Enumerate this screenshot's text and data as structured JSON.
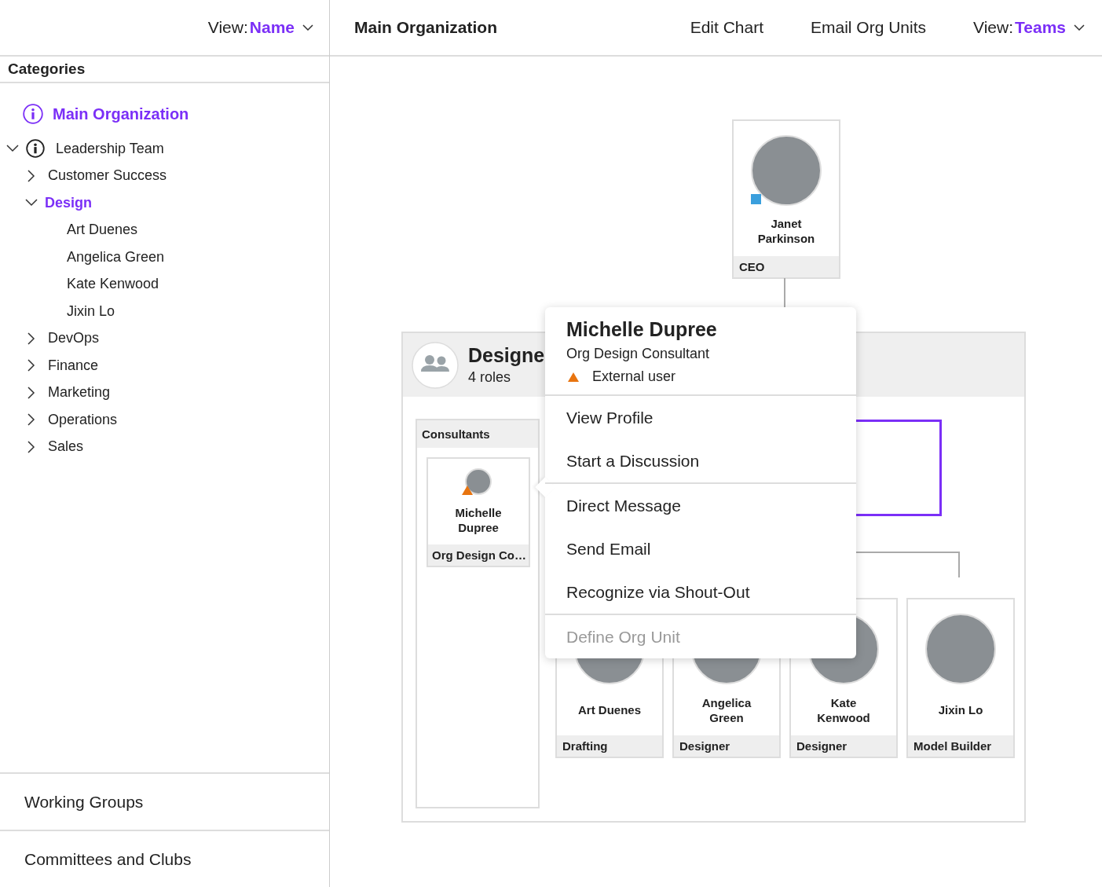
{
  "sidebar": {
    "view": {
      "label": "View:",
      "value": "Name"
    },
    "heading": "Categories",
    "tree": [
      {
        "label": "Main Organization",
        "kind": "root",
        "selected": true,
        "info": true
      },
      {
        "label": "Leadership Team",
        "kind": "group",
        "expanded": true,
        "selected": false,
        "info": true,
        "children": [
          {
            "label": "Customer Success",
            "kind": "group",
            "expanded": false,
            "selected": false,
            "info": false
          },
          {
            "label": "Design",
            "kind": "group",
            "expanded": true,
            "selected": true,
            "children": [
              {
                "label": "Art Duenes",
                "kind": "leaf",
                "selected": false
              },
              {
                "label": "Angelica Green",
                "kind": "leaf",
                "selected": false
              },
              {
                "label": "Kate Kenwood",
                "kind": "leaf",
                "selected": false
              },
              {
                "label": "Jixin Lo",
                "kind": "leaf",
                "selected": false
              }
            ]
          },
          {
            "label": "DevOps",
            "kind": "group",
            "expanded": false,
            "selected": false
          },
          {
            "label": "Finance",
            "kind": "group",
            "expanded": false,
            "selected": false
          },
          {
            "label": "Marketing",
            "kind": "group",
            "expanded": false,
            "selected": false
          },
          {
            "label": "Operations",
            "kind": "group",
            "expanded": false,
            "selected": false
          },
          {
            "label": "Sales",
            "kind": "group",
            "expanded": false,
            "selected": false
          }
        ]
      }
    ],
    "sections": [
      "Working Groups",
      "Committees and Clubs"
    ]
  },
  "header": {
    "title": "Main Organization",
    "actions": [
      "Edit Chart",
      "Email Org Units"
    ],
    "view": {
      "label": "View:",
      "value": "Teams"
    }
  },
  "chart": {
    "head": {
      "name": "Janet Parkinson",
      "role": "CEO",
      "presence": true,
      "external": false
    },
    "team": {
      "title": "Designe",
      "subtitle": "4 roles",
      "column": {
        "title": "Consultants",
        "members": [
          {
            "name": "Michelle Dupree",
            "role": "Org Design Co…",
            "presence": false,
            "external": true
          }
        ]
      },
      "members": [
        {
          "name": "Art Duenes",
          "role": "Drafting",
          "presence": false,
          "external": false
        },
        {
          "name": "Angelica Green",
          "role": "Designer",
          "presence": false,
          "external": false
        },
        {
          "name": "Kate Kenwood",
          "role": "Designer",
          "presence": false,
          "external": false
        },
        {
          "name": "Jixin Lo",
          "role": "Model Builder",
          "presence": false,
          "external": false
        }
      ]
    }
  },
  "popup": {
    "name": "Michelle Dupree",
    "title": "Org Design Consultant",
    "badge": "External user",
    "groups": [
      [
        {
          "label": "View Profile",
          "disabled": false
        },
        {
          "label": "Start a Discussion",
          "disabled": false
        }
      ],
      [
        {
          "label": "Direct Message",
          "disabled": false
        },
        {
          "label": "Send Email",
          "disabled": false
        },
        {
          "label": "Recognize via Shout-Out",
          "disabled": false
        }
      ],
      [
        {
          "label": "Define Org Unit",
          "disabled": true
        }
      ]
    ]
  }
}
